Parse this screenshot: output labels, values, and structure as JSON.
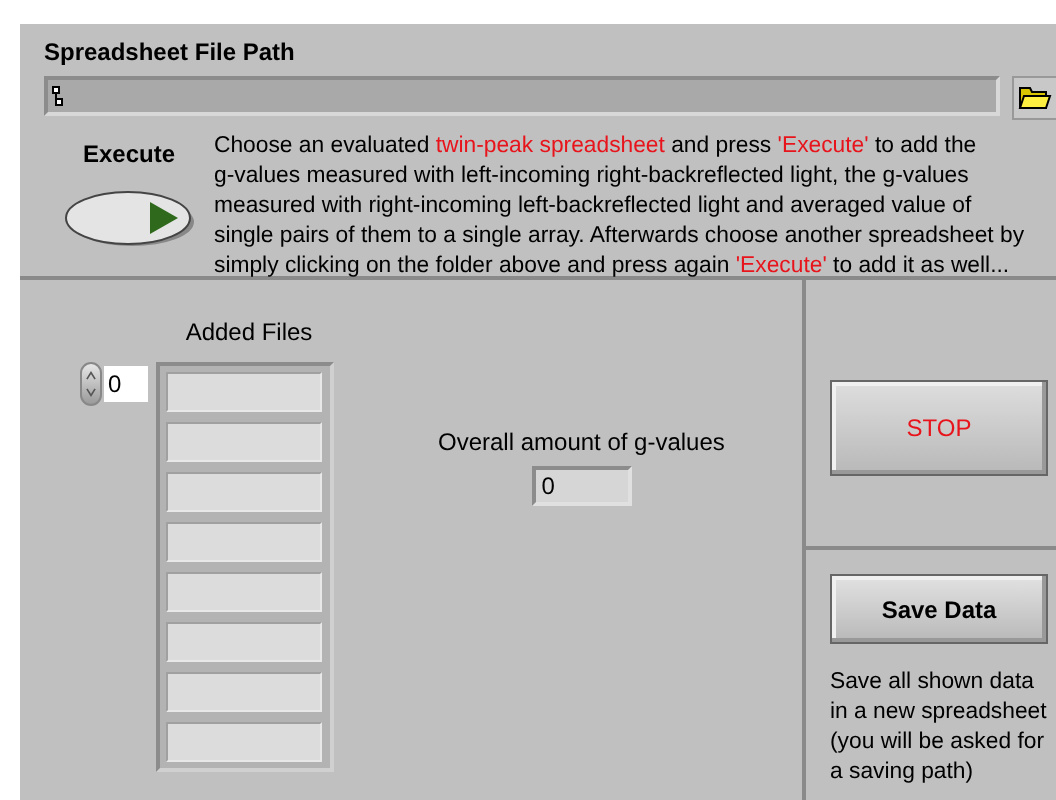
{
  "path_control": {
    "label": "Spreadsheet File Path"
  },
  "execute": {
    "label": "Execute"
  },
  "description": {
    "lines": [
      [
        {
          "text": "Choose an evaluated ",
          "highlight": false
        },
        {
          "text": "twin-peak spreadsheet",
          "highlight": true
        },
        {
          "text": " and press ",
          "highlight": false
        },
        {
          "text": "'Execute'",
          "highlight": true
        },
        {
          "text": " to add the",
          "highlight": false
        }
      ],
      [
        {
          "text": "g-values measured with left-incoming right-backreflected light, the g-values",
          "highlight": false
        }
      ],
      [
        {
          "text": "measured with right-incoming left-backreflected light and averaged value of",
          "highlight": false
        }
      ],
      [
        {
          "text": "single pairs of them to a single array. Afterwards choose another spreadsheet by",
          "highlight": false
        }
      ],
      [
        {
          "text": "simply clicking on the folder above and press again ",
          "highlight": false
        },
        {
          "text": "'Execute'",
          "highlight": true
        },
        {
          "text": " to add it as well...",
          "highlight": false
        }
      ]
    ]
  },
  "added_files": {
    "label": "Added Files",
    "index": "0"
  },
  "overall": {
    "label": "Overall amount of g-values",
    "value": "0"
  },
  "stop": {
    "label": "STOP"
  },
  "save": {
    "label": "Save Data",
    "note": [
      "Save all shown data",
      "in a new spreadsheet",
      "(you will be asked for",
      "a saving path)"
    ]
  }
}
